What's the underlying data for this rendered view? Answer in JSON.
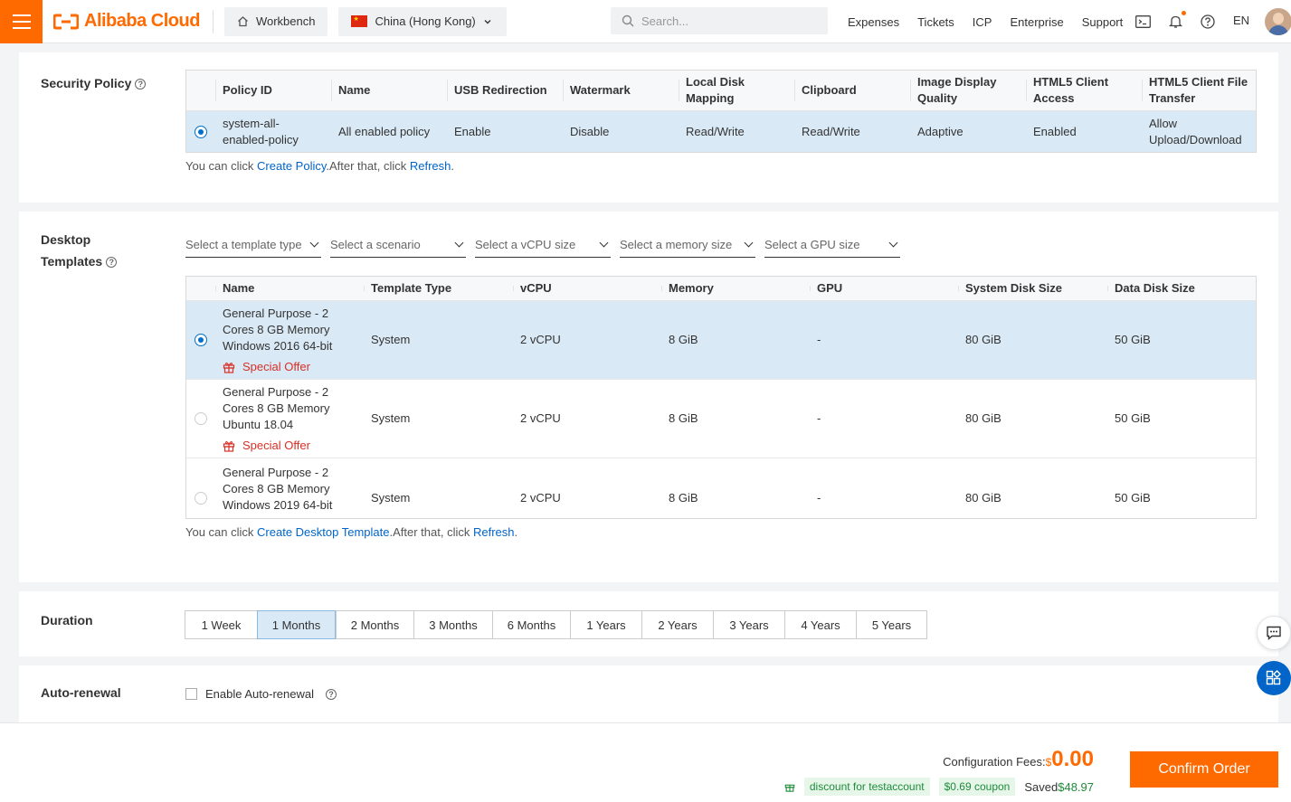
{
  "header": {
    "brand": "Alibaba Cloud",
    "workbench_label": "Workbench",
    "region_label": "China (Hong Kong)",
    "search_placeholder": "Search...",
    "nav": [
      "Expenses",
      "Tickets",
      "ICP",
      "Enterprise",
      "Support"
    ],
    "language": "EN"
  },
  "security_policy": {
    "title": "Security Policy",
    "columns": [
      "Policy ID",
      "Name",
      "USB Redirection",
      "Watermark",
      "Local Disk Mapping",
      "Clipboard",
      "Image Display Quality",
      "HTML5 Client Access",
      "HTML5 Client File Transfer"
    ],
    "rows": [
      {
        "selected": true,
        "cells": [
          "system-all-enabled-policy",
          "All enabled policy",
          "Enable",
          "Disable",
          "Read/Write",
          "Read/Write",
          "Adaptive",
          "Enabled",
          "Allow Upload/Download"
        ]
      }
    ],
    "hint_prefix": "You can click",
    "hint_link1": "Create Policy",
    "hint_middle": ".After that, click",
    "hint_link2": "Refresh",
    "hint_suffix": "."
  },
  "desktop_templates": {
    "title_line1": "Desktop",
    "title_line2": "Templates",
    "filters": [
      "Select a template type",
      "Select a scenario",
      "Select a vCPU size",
      "Select a memory size",
      "Select a GPU size"
    ],
    "columns": [
      "Name",
      "Template Type",
      "vCPU",
      "Memory",
      "GPU",
      "System Disk Size",
      "Data Disk Size"
    ],
    "rows": [
      {
        "selected": true,
        "name": "General Purpose - 2 Cores 8 GB Memory Windows 2016 64-bit",
        "offer": "Special Offer",
        "cells": [
          "System",
          "2 vCPU",
          "8 GiB",
          "-",
          "80 GiB",
          "50 GiB"
        ]
      },
      {
        "selected": false,
        "name": "General Purpose - 2 Cores 8 GB Memory Ubuntu 18.04",
        "offer": "Special Offer",
        "cells": [
          "System",
          "2 vCPU",
          "8 GiB",
          "-",
          "80 GiB",
          "50 GiB"
        ]
      },
      {
        "selected": false,
        "name": "General Purpose - 2 Cores 8 GB Memory Windows 2019 64-bit",
        "offer": "",
        "cells": [
          "System",
          "2 vCPU",
          "8 GiB",
          "-",
          "80 GiB",
          "50 GiB"
        ]
      }
    ],
    "hint_prefix": "You can click",
    "hint_link1": "Create Desktop Template",
    "hint_middle": ".After that, click",
    "hint_link2": "Refresh",
    "hint_suffix": "."
  },
  "duration": {
    "title": "Duration",
    "options": [
      "1 Week",
      "1 Months",
      "2 Months",
      "3 Months",
      "6 Months",
      "1 Years",
      "2 Years",
      "3 Years",
      "4 Years",
      "5 Years"
    ],
    "selected": "1 Months"
  },
  "auto_renewal": {
    "title": "Auto-renewal",
    "checkbox_label": "Enable Auto-renewal",
    "checked": false
  },
  "footer": {
    "fees_label": "Configuration Fees:",
    "currency": "$",
    "amount": "0.00",
    "discount_tag": "discount for testaccount",
    "coupon_tag": "$0.69 coupon",
    "saved_label": "Saved",
    "saved_amount": "$48.97",
    "confirm_label": "Confirm Order"
  },
  "colors": {
    "brand": "#ff6a00",
    "link": "#0064c8",
    "selected_row": "#d9e9f5",
    "offer": "#d93026",
    "discount": "#1f8b3a"
  }
}
